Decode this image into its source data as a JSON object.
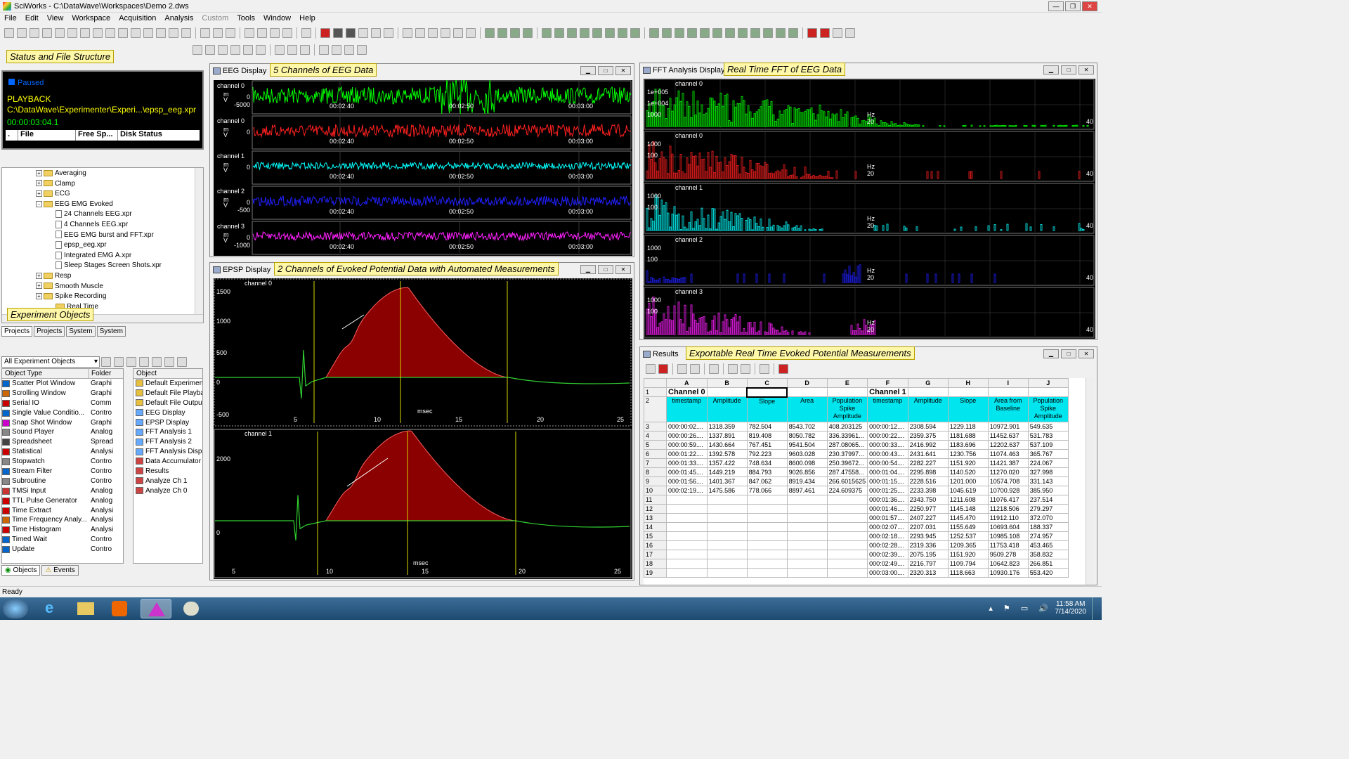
{
  "window": {
    "title": "SciWorks - C:\\DataWave\\Workspaces\\Demo 2.dws"
  },
  "menu": [
    "File",
    "Edit",
    "View",
    "Workspace",
    "Acquisition",
    "Analysis",
    "Custom",
    "Tools",
    "Window",
    "Help"
  ],
  "callouts": {
    "status": "Status and File Structure",
    "experiment": "Experiment Objects",
    "eeg": "5 Channels of EEG Data",
    "fft": "Real Time FFT of EEG Data",
    "epsp": "2 Channels of Evoked Potential Data with Automated Measurements",
    "results": "Exportable Real Time Evoked Potential Measurements"
  },
  "status": {
    "state": "Paused",
    "mode": "PLAYBACK",
    "path": "C:\\DataWave\\Experimenter\\Experi...\\epsp_eeg.xpr",
    "time": "00:00:03:04.1",
    "cols": [
      ".",
      "File",
      "Free Sp...",
      "Disk Status"
    ]
  },
  "tree": [
    {
      "label": "Averaging",
      "type": "folder",
      "indent": 1,
      "pm": "+"
    },
    {
      "label": "Clamp",
      "type": "folder",
      "indent": 1,
      "pm": "+"
    },
    {
      "label": "ECG",
      "type": "folder",
      "indent": 1,
      "pm": "+"
    },
    {
      "label": "EEG EMG Evoked",
      "type": "folder",
      "indent": 1,
      "pm": "-"
    },
    {
      "label": "24 Channels EEG.xpr",
      "type": "file",
      "indent": 2
    },
    {
      "label": "4 Channels EEG.xpr",
      "type": "file",
      "indent": 2
    },
    {
      "label": "EEG EMG burst and FFT.xpr",
      "type": "file",
      "indent": 2
    },
    {
      "label": "epsp_eeg.xpr",
      "type": "file",
      "indent": 2
    },
    {
      "label": "Integrated EMG A.xpr",
      "type": "file",
      "indent": 2
    },
    {
      "label": "Sleep Stages Screen Shots.xpr",
      "type": "file",
      "indent": 2
    },
    {
      "label": "Resp",
      "type": "folder",
      "indent": 1,
      "pm": "+"
    },
    {
      "label": "Smooth Muscle",
      "type": "folder",
      "indent": 1,
      "pm": "+"
    },
    {
      "label": "Spike Recording",
      "type": "folder",
      "indent": 1,
      "pm": "+"
    },
    {
      "label": "Real Time",
      "type": "folder",
      "indent": 2
    }
  ],
  "tabs1": [
    "Projects",
    "Projects",
    "System",
    "System"
  ],
  "objpanel": {
    "dropdown": "All Experiment Objects",
    "col1": "Object Type",
    "col2": "Folder",
    "col3": "Object",
    "types": [
      [
        "Scatter Plot Window",
        "Graphi"
      ],
      [
        "Scrolling Window",
        "Graphi"
      ],
      [
        "Serial IO",
        "Comm"
      ],
      [
        "Single Value Conditio...",
        "Contro"
      ],
      [
        "Snap Shot Window",
        "Graphi"
      ],
      [
        "Sound Player",
        "Analog"
      ],
      [
        "Spreadsheet",
        "Spread"
      ],
      [
        "Statistical",
        "Analysi"
      ],
      [
        "Stopwatch",
        "Contro"
      ],
      [
        "Stream Filter",
        "Contro"
      ],
      [
        "Subroutine",
        "Contro"
      ],
      [
        "TMSi Input",
        "Analog"
      ],
      [
        "TTL Pulse Generator",
        "Analog"
      ],
      [
        "Time Extract",
        "Analysi"
      ],
      [
        "Time Frequency Analy...",
        "Analysi"
      ],
      [
        "Time Histogram",
        "Analysi"
      ],
      [
        "Timed Wait",
        "Contro"
      ],
      [
        "Update",
        "Contro"
      ]
    ],
    "objects": [
      "Default Experiment",
      "Default File Playba",
      "Default File Output",
      "EEG Display",
      "EPSP Display",
      "FFT Analysis 1",
      "FFT Analysis 2",
      "FFT Analysis Displa",
      "Data Accumulator",
      "Results",
      "Analyze Ch 1",
      "Analyze Ch 0"
    ],
    "tabs": [
      "Objects",
      "Events"
    ]
  },
  "eeg": {
    "title": "EEG Display",
    "channels": [
      {
        "name": "channel 0",
        "unit": "m\nV",
        "ticks": [
          "0",
          "-5000"
        ],
        "color": "#00ff00"
      },
      {
        "name": "channel 0",
        "unit": "m\nV",
        "ticks": [
          "0"
        ],
        "color": "#ff2020"
      },
      {
        "name": "channel 1",
        "unit": "m\nV",
        "ticks": [
          "0"
        ],
        "color": "#00ffff"
      },
      {
        "name": "channel 2",
        "unit": "m\nV",
        "ticks": [
          "0",
          "-500"
        ],
        "color": "#2020ff"
      },
      {
        "name": "channel 3",
        "unit": "m\nV",
        "ticks": [
          "0",
          "-1000"
        ],
        "color": "#ff20ff"
      }
    ],
    "xticks": [
      "00:02:40",
      "00:02:50",
      "00:03:00"
    ]
  },
  "fft": {
    "title": "FFT Analysis Display",
    "channels": [
      {
        "name": "channel 0",
        "ticks": [
          "1e+005",
          "1e+004",
          "1000"
        ],
        "color": "#00ff00"
      },
      {
        "name": "channel 0",
        "ticks": [
          "1000",
          "100"
        ],
        "color": "#ff2020"
      },
      {
        "name": "channel 1",
        "ticks": [
          "1000",
          "100"
        ],
        "color": "#00ffff"
      },
      {
        "name": "channel 2",
        "ticks": [
          "1000",
          "100"
        ],
        "color": "#2020ff"
      },
      {
        "name": "channel 3",
        "ticks": [
          "1000",
          "100"
        ],
        "color": "#ff20ff"
      }
    ],
    "hz": "Hz",
    "x20": "20",
    "x40": "40"
  },
  "epsp": {
    "title": "EPSP Display",
    "ch0": {
      "name": "channel 0",
      "yticks": [
        "1500",
        "1000",
        "500",
        "0",
        "-500"
      ],
      "xticks": [
        "5",
        "10",
        "15",
        "20",
        "25"
      ],
      "xlabel": "msec"
    },
    "ch1": {
      "name": "channel 1",
      "yticks": [
        "2000",
        "0"
      ],
      "xticks": [
        "5",
        "10",
        "15",
        "20",
        "25"
      ],
      "xlabel": "msec"
    }
  },
  "results": {
    "title": "Results",
    "colletters": [
      "A",
      "B",
      "C",
      "D",
      "E",
      "F",
      "G",
      "H",
      "I",
      "J"
    ],
    "header1": [
      "Channel 0",
      "",
      "",
      "",
      "",
      "Channel 1",
      "",
      "",
      "",
      ""
    ],
    "header2": [
      "timestamp",
      "Amplitude",
      "Slope",
      "Area",
      "Population Spike Amplitude",
      "timestamp",
      "Amplitude",
      "Slope",
      "Area from Baseline",
      "Population Spike Amplitude"
    ],
    "rows": [
      [
        "000:00:02....",
        "1318.359",
        "782.504",
        "8543.702",
        "408.203125",
        "000:00:12....",
        "2308.594",
        "1229.118",
        "10972.901",
        "549.635"
      ],
      [
        "000:00:26....",
        "1337.891",
        "819.408",
        "8050.782",
        "336.33961...",
        "000:00:22....",
        "2359.375",
        "1181.688",
        "11452.637",
        "531.783"
      ],
      [
        "000:00:59....",
        "1430.664",
        "767.451",
        "9541.504",
        "287.08065...",
        "000:00:33....",
        "2416.992",
        "1183.696",
        "12202.637",
        "537.109"
      ],
      [
        "000:01:22....",
        "1392.578",
        "792.223",
        "9603.028",
        "230.37997...",
        "000:00:43....",
        "2431.641",
        "1230.756",
        "11074.463",
        "365.767"
      ],
      [
        "000:01:33....",
        "1357.422",
        "748.634",
        "8600.098",
        "250.39672...",
        "000:00:54....",
        "2282.227",
        "1151.920",
        "11421.387",
        "224.067"
      ],
      [
        "000:01:45....",
        "1449.219",
        "884.793",
        "9026.856",
        "287.47558...",
        "000:01:04....",
        "2295.898",
        "1140.520",
        "11270.020",
        "327.998"
      ],
      [
        "000:01:56....",
        "1401.367",
        "847.062",
        "8919.434",
        "266.6015625",
        "000:01:15....",
        "2228.516",
        "1201.000",
        "10574.708",
        "331.143"
      ],
      [
        "000:02:19....",
        "1475.586",
        "778.066",
        "8897.461",
        "224.609375",
        "000:01:25....",
        "2233.398",
        "1045.619",
        "10700.928",
        "385.950"
      ],
      [
        "",
        "",
        "",
        "",
        "",
        "000:01:36....",
        "2343.750",
        "1211.608",
        "11076.417",
        "237.514"
      ],
      [
        "",
        "",
        "",
        "",
        "",
        "000:01:46....",
        "2250.977",
        "1145.148",
        "11218.506",
        "279.297"
      ],
      [
        "",
        "",
        "",
        "",
        "",
        "000:01:57....",
        "2407.227",
        "1145.470",
        "11912.110",
        "372.070"
      ],
      [
        "",
        "",
        "",
        "",
        "",
        "000:02:07....",
        "2207.031",
        "1155.649",
        "10693.604",
        "188.337"
      ],
      [
        "",
        "",
        "",
        "",
        "",
        "000:02:18....",
        "2293.945",
        "1252.537",
        "10985.108",
        "274.957"
      ],
      [
        "",
        "",
        "",
        "",
        "",
        "000:02:28....",
        "2319.336",
        "1209.365",
        "11753.418",
        "453.465"
      ],
      [
        "",
        "",
        "",
        "",
        "",
        "000:02:39....",
        "2075.195",
        "1151.920",
        "9509.278",
        "358.832"
      ],
      [
        "",
        "",
        "",
        "",
        "",
        "000:02:49....",
        "2216.797",
        "1109.794",
        "10642.823",
        "266.851"
      ],
      [
        "",
        "",
        "",
        "",
        "",
        "000:03:00....",
        "2320.313",
        "1118.663",
        "10930.176",
        "553.420"
      ]
    ]
  },
  "statusbar": "Ready",
  "clock": {
    "time": "11:58 AM",
    "date": "7/14/2020"
  }
}
